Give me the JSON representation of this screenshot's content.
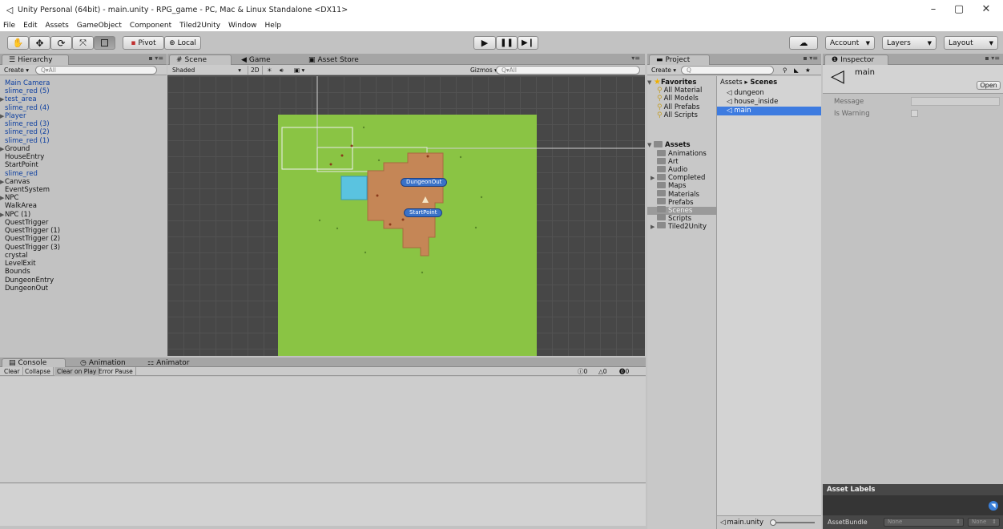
{
  "window": {
    "title": "Unity Personal (64bit) - main.unity - RPG_game - PC, Mac & Linux Standalone <DX11>",
    "minimize": "–",
    "maximize": "▢",
    "close": "✕"
  },
  "menu": [
    "File",
    "Edit",
    "Assets",
    "GameObject",
    "Component",
    "Tiled2Unity",
    "Window",
    "Help"
  ],
  "toolbar": {
    "pivot": "Pivot",
    "local": "Local",
    "account": "Account",
    "layers": "Layers",
    "layout": "Layout"
  },
  "hierarchy": {
    "tab": "Hierarchy",
    "create": "Create",
    "search_placeholder": "Q▾All",
    "items": [
      {
        "label": "Main Camera",
        "blue": true,
        "arrow": false
      },
      {
        "label": "slime_red (5)",
        "blue": true,
        "arrow": false
      },
      {
        "label": "test_area",
        "blue": true,
        "arrow": true
      },
      {
        "label": "slime_red (4)",
        "blue": true,
        "arrow": false
      },
      {
        "label": "Player",
        "blue": true,
        "arrow": true
      },
      {
        "label": "slime_red (3)",
        "blue": true,
        "arrow": false
      },
      {
        "label": "slime_red (2)",
        "blue": true,
        "arrow": false
      },
      {
        "label": "slime_red (1)",
        "blue": true,
        "arrow": false
      },
      {
        "label": "Ground",
        "blue": false,
        "arrow": true
      },
      {
        "label": "HouseEntry",
        "blue": false,
        "arrow": false
      },
      {
        "label": "StartPoint",
        "blue": false,
        "arrow": false
      },
      {
        "label": "slime_red",
        "blue": true,
        "arrow": false
      },
      {
        "label": "Canvas",
        "blue": false,
        "arrow": true
      },
      {
        "label": "EventSystem",
        "blue": false,
        "arrow": false
      },
      {
        "label": "NPC",
        "blue": false,
        "arrow": true
      },
      {
        "label": "WalkArea",
        "blue": false,
        "arrow": false
      },
      {
        "label": "NPC (1)",
        "blue": false,
        "arrow": true
      },
      {
        "label": "QuestTrigger",
        "blue": false,
        "arrow": false
      },
      {
        "label": "QuestTrigger (1)",
        "blue": false,
        "arrow": false
      },
      {
        "label": "QuestTrigger (2)",
        "blue": false,
        "arrow": false
      },
      {
        "label": "QuestTrigger (3)",
        "blue": false,
        "arrow": false
      },
      {
        "label": "crystal",
        "blue": false,
        "arrow": false
      },
      {
        "label": "LevelExit",
        "blue": false,
        "arrow": false
      },
      {
        "label": "Bounds",
        "blue": false,
        "arrow": false
      },
      {
        "label": "DungeonEntry",
        "blue": false,
        "arrow": false
      },
      {
        "label": "DungeonOut",
        "blue": false,
        "arrow": false
      }
    ]
  },
  "scene": {
    "tabs": [
      "Scene",
      "Game",
      "Asset Store"
    ],
    "shading": "Shaded",
    "mode2d": "2D",
    "gizmos": "Gizmos",
    "search_placeholder": "Q▾All",
    "labels": {
      "dungeon_out": "DungeonOut",
      "start_point": "StartPoint"
    }
  },
  "console": {
    "tabs": [
      "Console",
      "Animation",
      "Animator"
    ],
    "buttons": [
      "Clear",
      "Collapse",
      "Clear on Play",
      "Error Pause"
    ],
    "counts": {
      "info": "0",
      "warn": "0",
      "error": "0"
    }
  },
  "project": {
    "tab": "Project",
    "create": "Create",
    "favorites_label": "Favorites",
    "favorites": [
      "All Material",
      "All Models",
      "All Prefabs",
      "All Scripts"
    ],
    "assets_label": "Assets",
    "folders": [
      {
        "label": "Animations",
        "arrow": false,
        "selected": false
      },
      {
        "label": "Art",
        "arrow": false,
        "selected": false
      },
      {
        "label": "Audio",
        "arrow": false,
        "selected": false
      },
      {
        "label": "Completed",
        "arrow": true,
        "selected": false
      },
      {
        "label": "Maps",
        "arrow": false,
        "selected": false
      },
      {
        "label": "Materials",
        "arrow": false,
        "selected": false
      },
      {
        "label": "Prefabs",
        "arrow": false,
        "selected": false
      },
      {
        "label": "Scenes",
        "arrow": false,
        "selected": true
      },
      {
        "label": "Scripts",
        "arrow": false,
        "selected": false
      },
      {
        "label": "Tiled2Unity",
        "arrow": true,
        "selected": false
      }
    ],
    "breadcrumb_root": "Assets",
    "breadcrumb_sep": "▸",
    "breadcrumb_current": "Scenes",
    "files": [
      {
        "label": "dungeon",
        "selected": false
      },
      {
        "label": "house_inside",
        "selected": false
      },
      {
        "label": "main",
        "selected": true
      }
    ],
    "footer_file": "main.unity"
  },
  "inspector": {
    "tab": "Inspector",
    "asset_name": "main",
    "open_button": "Open",
    "fields": [
      {
        "label": "Message"
      },
      {
        "label": "Is Warning"
      }
    ],
    "asset_labels": "Asset Labels",
    "asset_bundle": "AssetBundle",
    "bundle_value_1": "None",
    "bundle_value_2": "None"
  }
}
